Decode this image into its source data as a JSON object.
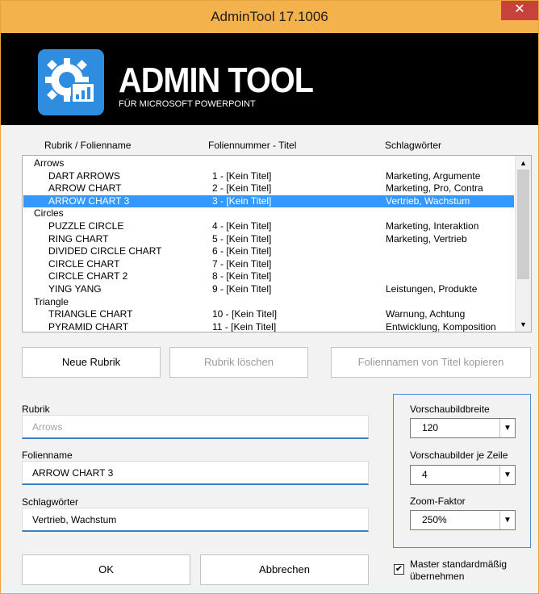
{
  "window": {
    "title": "AdminTool 17.1006",
    "close_glyph": "✕"
  },
  "banner": {
    "brand": "ADMIN TOOL",
    "subtitle": "FÜR MICROSOFT POWERPOINT",
    "logo_icon": "gear-chart-icon",
    "colors": {
      "accent": "#2f8de0",
      "background": "#000000",
      "titlebar": "#f3b24c"
    }
  },
  "list": {
    "headers": {
      "rubrik": "Rubrik / Folienname",
      "folie": "Foliennummer - Titel",
      "tags": "Schlagwörter"
    },
    "rows": [
      {
        "name": "Arrows",
        "type": "category",
        "slide": "",
        "tags": ""
      },
      {
        "name": "DART ARROWS",
        "type": "item",
        "slide": "1 - [Kein Titel]",
        "tags": "Marketing, Argumente"
      },
      {
        "name": "ARROW CHART",
        "type": "item",
        "slide": "2 - [Kein Titel]",
        "tags": "Marketing, Pro, Contra"
      },
      {
        "name": "ARROW CHART 3",
        "type": "item",
        "slide": "3 - [Kein Titel]",
        "tags": "Vertrieb, Wachstum",
        "selected": true
      },
      {
        "name": "Circles",
        "type": "category",
        "slide": "",
        "tags": ""
      },
      {
        "name": "PUZZLE CIRCLE",
        "type": "item",
        "slide": "4 - [Kein Titel]",
        "tags": "Marketing, Interaktion"
      },
      {
        "name": "RING CHART",
        "type": "item",
        "slide": "5 - [Kein Titel]",
        "tags": "Marketing, Vertrieb"
      },
      {
        "name": "DIVIDED CIRCLE CHART",
        "type": "item",
        "slide": "6 - [Kein Titel]",
        "tags": ""
      },
      {
        "name": "CIRCLE CHART",
        "type": "item",
        "slide": "7 - [Kein Titel]",
        "tags": ""
      },
      {
        "name": "CIRCLE CHART 2",
        "type": "item",
        "slide": "8 - [Kein Titel]",
        "tags": ""
      },
      {
        "name": "YING YANG",
        "type": "item",
        "slide": "9 - [Kein Titel]",
        "tags": "Leistungen, Produkte"
      },
      {
        "name": "Triangle",
        "type": "category",
        "slide": "",
        "tags": ""
      },
      {
        "name": "TRIANGLE CHART",
        "type": "item",
        "slide": "10 - [Kein Titel]",
        "tags": "Warnung, Achtung"
      },
      {
        "name": "PYRAMID CHART",
        "type": "item",
        "slide": "11 - [Kein Titel]",
        "tags": "Entwicklung, Komposition"
      }
    ],
    "scroll_up_glyph": "▲",
    "scroll_down_glyph": "▼"
  },
  "actions": {
    "new_category": "Neue Rubrik",
    "delete_category": "Rubrik löschen",
    "copy_names": "Foliennamen von Titel kopieren"
  },
  "form": {
    "rubrik_label": "Rubrik",
    "rubrik_value": "Arrows",
    "folienname_label": "Folienname",
    "folienname_value": "ARROW CHART 3",
    "tags_label": "Schlagwörter",
    "tags_value": "Vertrieb, Wachstum"
  },
  "options": {
    "preview_width_label": "Vorschaubildbreite",
    "preview_width_value": "120",
    "per_row_label": "Vorschaubilder je Zeile",
    "per_row_value": "4",
    "zoom_label": "Zoom-Faktor",
    "zoom_value": "250%",
    "dropdown_glyph": "▼"
  },
  "footer": {
    "ok": "OK",
    "cancel": "Abbrechen",
    "master_checked": true,
    "check_glyph": "✔",
    "master_label": "Master standardmäßig übernehmen"
  }
}
